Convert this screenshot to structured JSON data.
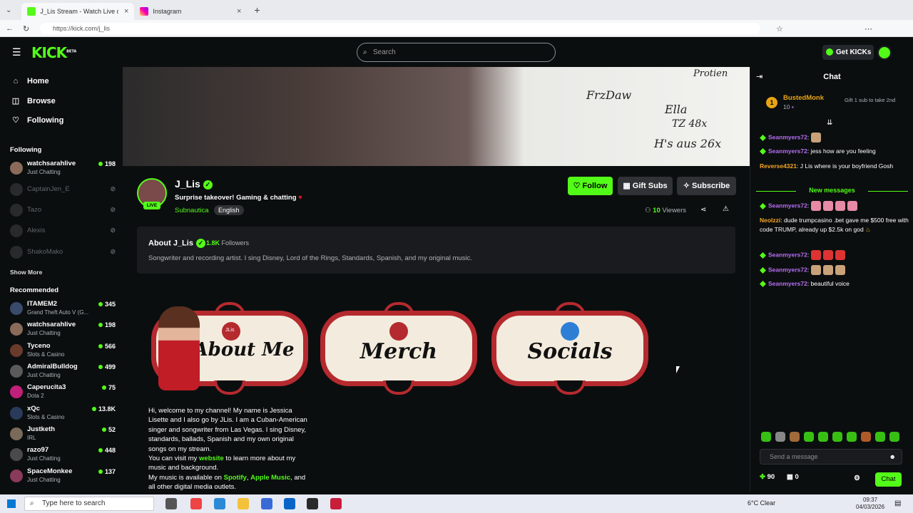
{
  "browser": {
    "tabs": [
      {
        "title": "J_Lis Stream - Watch Live on K",
        "active": true
      },
      {
        "title": "Instagram",
        "active": false
      }
    ],
    "url": "https://kick.com/j_lis"
  },
  "header": {
    "logo": "KICK",
    "logo_badge": "BETA",
    "search_placeholder": "Search",
    "get_kicks_label": "Get KICKs"
  },
  "sidebar": {
    "nav": [
      {
        "label": "Home",
        "icon": "home-icon"
      },
      {
        "label": "Browse",
        "icon": "browse-icon"
      },
      {
        "label": "Following",
        "icon": "heart-icon"
      }
    ],
    "following_title": "Following",
    "following": [
      {
        "name": "watchsarahlive",
        "category": "Just Chatting",
        "viewers": "198",
        "live": true
      },
      {
        "name": "CaptainJen_E",
        "live": false
      },
      {
        "name": "Tazo",
        "live": false
      },
      {
        "name": "Alexis",
        "live": false
      },
      {
        "name": "ShakoMako",
        "live": false
      }
    ],
    "show_more_label": "Show More",
    "recommended_title": "Recommended",
    "recommended": [
      {
        "name": "ITAMEM2",
        "category": "Grand Theft Auto V (G...",
        "viewers": "345"
      },
      {
        "name": "watchsarahlive",
        "category": "Just Chatting",
        "viewers": "198"
      },
      {
        "name": "Tyceno",
        "category": "Slots & Casino",
        "viewers": "566"
      },
      {
        "name": "AdmiralBulldog",
        "category": "Just Chatting",
        "viewers": "499"
      },
      {
        "name": "Caperucita3",
        "category": "Dota 2",
        "viewers": "75"
      },
      {
        "name": "xQc",
        "category": "Slots & Casino",
        "viewers": "13.8K"
      },
      {
        "name": "Justketh",
        "category": "IRL",
        "viewers": "52"
      },
      {
        "name": "razo97",
        "category": "Just Chatting",
        "viewers": "448"
      },
      {
        "name": "SpaceMonkee",
        "category": "Just Chatting",
        "viewers": "137"
      }
    ]
  },
  "stream": {
    "whiteboard_lines": [
      "Protien",
      "FrzDaw",
      "Ella",
      "TZ 48x",
      "H's aus 26x"
    ],
    "channel_name": "J_Lis",
    "live_label": "LIVE",
    "title": "Surprise takeover! Gaming & chatting",
    "category": "Subnautica",
    "language_tag": "English",
    "follow_label": "Follow",
    "gift_subs_label": "Gift Subs",
    "subscribe_label": "Subscribe",
    "viewers_count": "10",
    "viewers_label": "Viewers"
  },
  "about": {
    "title": "About J_Lis",
    "followers_count": "1.8K",
    "followers_label": "Followers",
    "bio": "Songwriter and recording artist. I sing Disney, Lord of the Rings, Standards, Spanish, and my original music."
  },
  "panels": [
    {
      "label": "About Me",
      "badge": "JLis"
    },
    {
      "label": "Merch"
    },
    {
      "label": "Socials"
    }
  ],
  "welcome": {
    "p1": "Hi, welcome to my channel! My name is Jessica Lisette and I also go by JLis. I am a Cuban-American singer and songwriter from Las Vegas. I sing Disney, standards, ballads, Spanish and my own original songs on my stream.",
    "p2a": "You can visit my ",
    "p2link": "website",
    "p2b": " to learn more about my music and background.",
    "p3a": "My music is available on ",
    "p3link1": "Spotify",
    "p3sep": ", ",
    "p3link2": "Apple Music",
    "p3b": ", and all other digital media outlets."
  },
  "chat": {
    "title": "Chat",
    "pinned_user": "BustedMonk",
    "pinned_rank": "1",
    "pinned_count": "10",
    "pinned_gift": "Gift 1 sub to take 2nd",
    "messages": [
      {
        "user": "Seanmyers72",
        "text": "",
        "color": "#b76ef5"
      },
      {
        "user": "Seanmyers72",
        "text": "jess how are you feeling",
        "color": "#b76ef5"
      },
      {
        "user": "Reverse4321",
        "text": "J Lis where is your boyfriend Gosh",
        "color": "#f5a623"
      },
      {
        "user": "Seanmyers72",
        "text": "",
        "color": "#b76ef5"
      },
      {
        "user": "Neolzzi",
        "text": "dude trumpcasino .bet gave me $500 free with code TRUMP, already up $2.5k on god",
        "color": "#f5a623"
      },
      {
        "user": "Seanmyers72",
        "text": "",
        "color": "#b76ef5"
      },
      {
        "user": "Seanmyers72",
        "text": "",
        "color": "#b76ef5"
      },
      {
        "user": "Seanmyers72",
        "text": "beautiful voice",
        "color": "#b76ef5"
      }
    ],
    "new_messages_label": "New messages",
    "input_placeholder": "Send a message",
    "kicks_count": "90",
    "gifts_count": "0",
    "send_label": "Chat"
  },
  "taskbar": {
    "search_placeholder": "Type here to search",
    "weather": "6°C  Clear",
    "time": "09:37",
    "date": "04/03/2026"
  }
}
